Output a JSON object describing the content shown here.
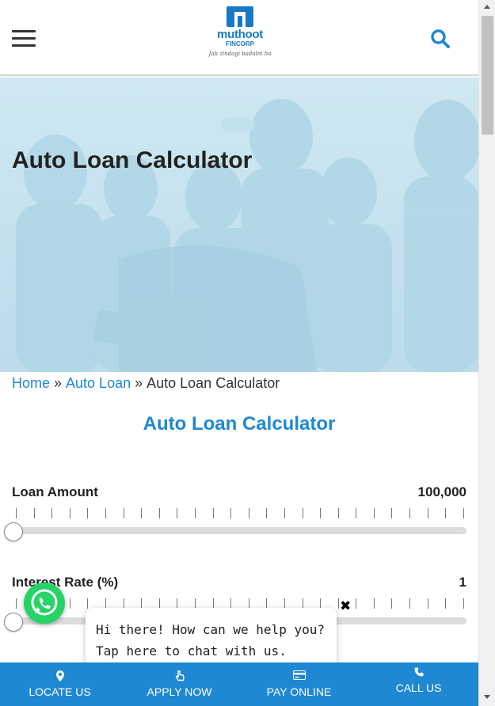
{
  "header": {
    "logo": {
      "brand": "muthoot",
      "sub": "FINCORP",
      "tagline": "Jab zindagi badalni ho"
    },
    "menu_icon": "hamburger-icon",
    "search_icon": "search-icon"
  },
  "hero": {
    "title": "Auto Loan Calculator"
  },
  "breadcrumb": {
    "home": "Home",
    "separator": "»",
    "parent": "Auto Loan",
    "current": "Auto Loan Calculator"
  },
  "calculator": {
    "title": "Auto Loan Calculator",
    "loan_amount": {
      "label": "Loan Amount",
      "value": "100,000",
      "position": 0
    },
    "interest_rate": {
      "label": "Interest Rate (%)",
      "value": "1",
      "position": 0
    }
  },
  "chat": {
    "close_symbol": "✖",
    "message": "Hi there! How can we help you? Tap here to chat with us."
  },
  "bottom_nav": [
    {
      "label": "LOCATE US",
      "icon": "map-pin-icon"
    },
    {
      "label": "APPLY NOW",
      "icon": "hand-pointer-icon"
    },
    {
      "label": "PAY ONLINE",
      "icon": "credit-card-icon"
    },
    {
      "label": "CALL US",
      "icon": "phone-icon"
    }
  ],
  "colors": {
    "brand_blue": "#1e88d2",
    "whatsapp_green": "#25d366"
  }
}
